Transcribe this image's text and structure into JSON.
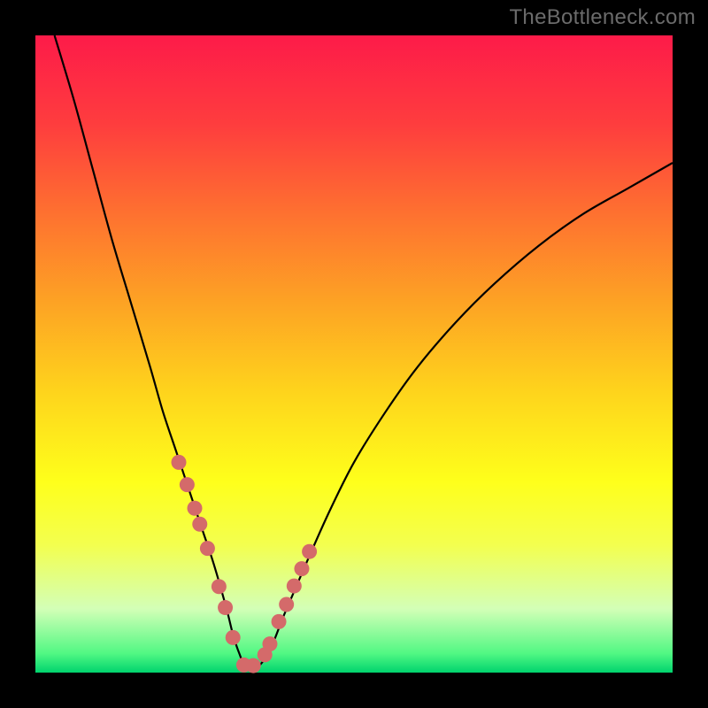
{
  "attribution": "TheBottleneck.com",
  "chart_data": {
    "type": "line",
    "title": "",
    "xlabel": "",
    "ylabel": "",
    "xlim": [
      0,
      100
    ],
    "ylim": [
      0,
      100
    ],
    "series": [
      {
        "name": "bottleneck-curve",
        "x": [
          3,
          6,
          9,
          12,
          15,
          18,
          20,
          22,
          24,
          26,
          28,
          30,
          31,
          32,
          33,
          35,
          37,
          39,
          42,
          46,
          50,
          55,
          60,
          66,
          72,
          79,
          86,
          93,
          100
        ],
        "y": [
          100,
          90,
          79,
          68,
          58,
          48,
          41,
          35,
          29,
          23,
          17,
          10,
          6,
          3,
          1,
          1,
          4,
          9,
          16,
          25,
          33,
          41,
          48,
          55,
          61,
          67,
          72,
          76,
          80
        ]
      }
    ],
    "markers": {
      "name": "highlighted-points",
      "x": [
        22.5,
        23.8,
        25.0,
        25.8,
        27.0,
        28.8,
        29.8,
        31.0,
        32.7,
        34.2,
        36.0,
        36.8,
        38.2,
        39.4,
        40.6,
        41.8,
        43.0
      ],
      "y": [
        33.0,
        29.5,
        25.8,
        23.3,
        19.5,
        13.5,
        10.2,
        5.5,
        1.2,
        1.1,
        2.8,
        4.5,
        8.0,
        10.7,
        13.6,
        16.3,
        19.0
      ]
    },
    "gradient_stops": [
      {
        "offset": 0,
        "color": "#fd1b49"
      },
      {
        "offset": 14,
        "color": "#fe3d3e"
      },
      {
        "offset": 28,
        "color": "#fe7130"
      },
      {
        "offset": 42,
        "color": "#fda324"
      },
      {
        "offset": 56,
        "color": "#fed41c"
      },
      {
        "offset": 70,
        "color": "#feff1b"
      },
      {
        "offset": 80,
        "color": "#f3ff4f"
      },
      {
        "offset": 90,
        "color": "#d3ffb7"
      },
      {
        "offset": 97,
        "color": "#51f883"
      },
      {
        "offset": 100,
        "color": "#00d36e"
      }
    ]
  }
}
